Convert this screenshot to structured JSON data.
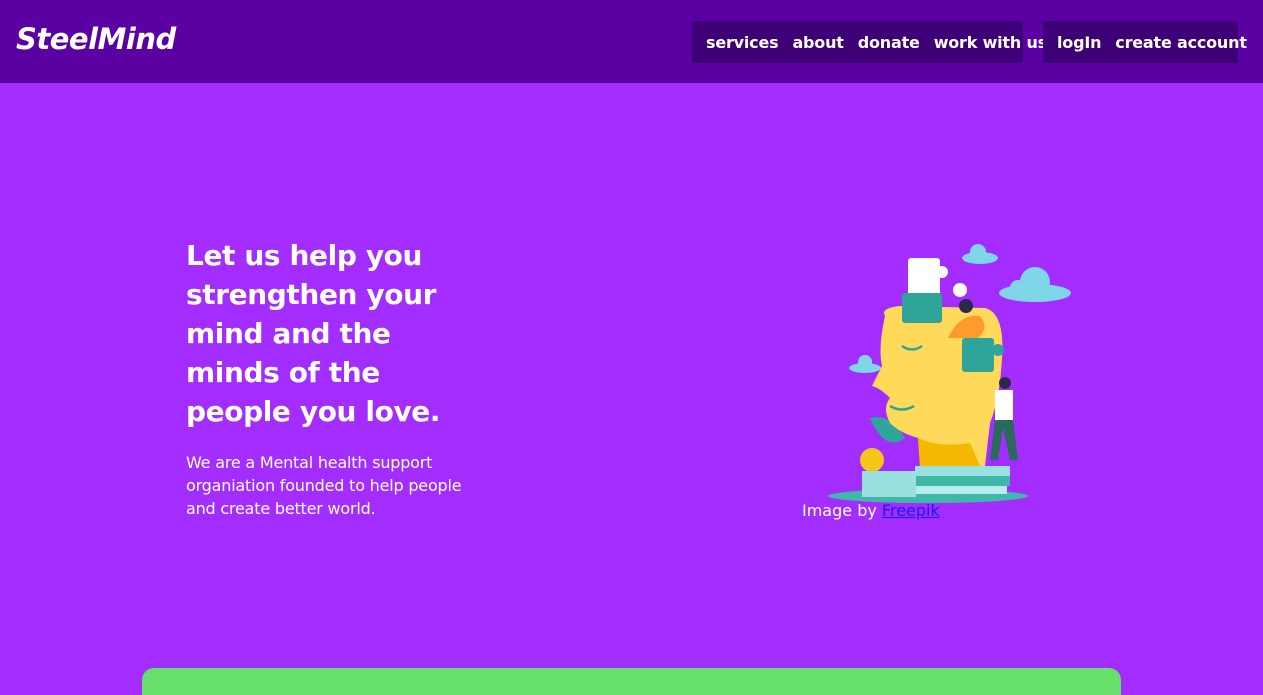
{
  "header": {
    "brand": "SteelMind",
    "nav": [
      {
        "label": "services"
      },
      {
        "label": "about"
      },
      {
        "label": "donate"
      },
      {
        "label": "work with us"
      }
    ],
    "auth": [
      {
        "label": "logIn"
      },
      {
        "label": "create account"
      }
    ]
  },
  "hero": {
    "title": "Let us help you strengthen your mind and the minds of the people you love.",
    "description": "We are a Mental health support organiation founded to help people and create better world.",
    "image_credit_prefix": "Image by",
    "image_credit_link": "Freepik"
  },
  "colors": {
    "header_bg": "#5b01a4",
    "nav_bg": "#3e0076",
    "page_bg": "#a32cfe",
    "panel_bg": "#66e06a",
    "link": "#1a1aff"
  },
  "icons": [
    "mind-puzzle-illustration"
  ]
}
